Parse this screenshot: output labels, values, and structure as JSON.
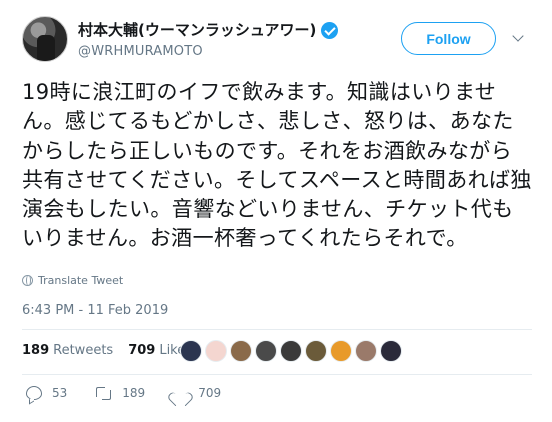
{
  "header": {
    "display_name": "村本大輔(ウーマンラッシュアワー)",
    "handle": "@WRHMURAMOTO",
    "follow_label": "Follow"
  },
  "tweet": {
    "text": "19時に浪江町のイフで飲みます。知識はいりません。感じてるもどかしさ、悲しさ、怒りは、あなたからしたら正しいものです。それをお酒飲みながら共有させてください。そしてスペースと時間あれば独演会もしたい。音響などいりません、チケット代もいりません。お酒一杯奢ってくれたらそれで。",
    "translate_label": "Translate Tweet",
    "timestamp": "6:43 PM - 11 Feb 2019"
  },
  "stats": {
    "retweets_count": "189",
    "retweets_label": "Retweets",
    "likes_count": "709",
    "likes_label": "Likes",
    "liker_colors": [
      "#2b3550",
      "#f4d6d0",
      "#8a6a4a",
      "#4a4a4a",
      "#3a3a3a",
      "#6b5b3a",
      "#e89a2a",
      "#9a7a6a",
      "#2a2a3a"
    ]
  },
  "actions": {
    "replies": "53",
    "retweets": "189",
    "likes": "709"
  },
  "colors": {
    "accent": "#1da1f2",
    "muted": "#657786",
    "text": "#14171a"
  }
}
